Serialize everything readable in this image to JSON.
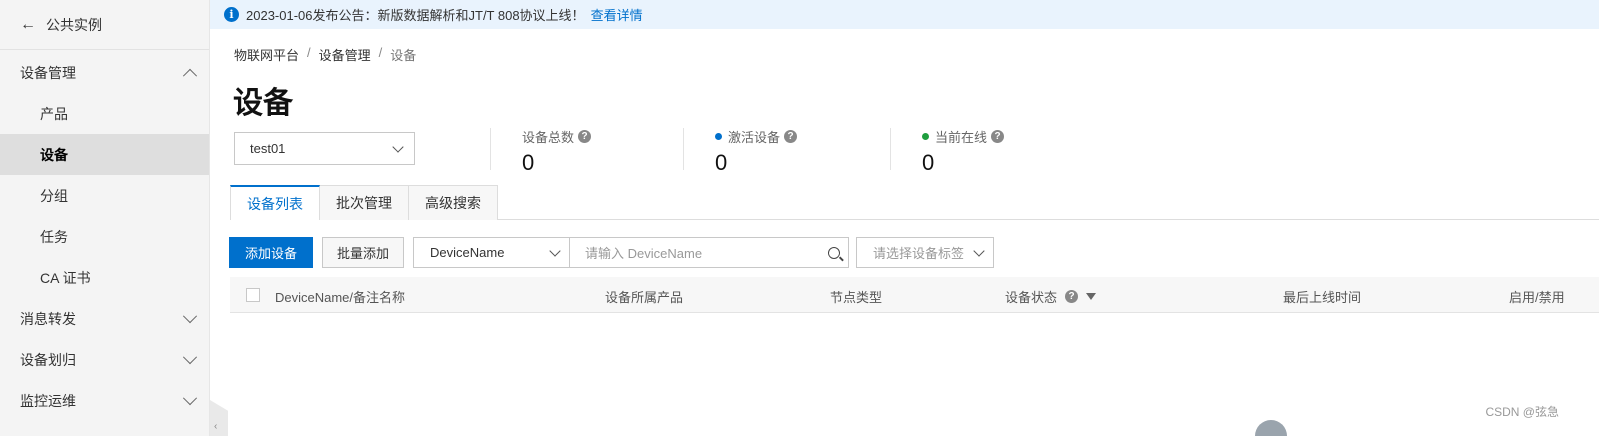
{
  "sidebar": {
    "back_label": "公共实例",
    "groups": [
      {
        "label": "设备管理",
        "expanded": true
      },
      {
        "label": "消息转发",
        "expanded": false
      },
      {
        "label": "设备划归",
        "expanded": false
      },
      {
        "label": "监控运维",
        "expanded": false
      }
    ],
    "items": [
      "产品",
      "设备",
      "分组",
      "任务",
      "CA 证书"
    ],
    "active_item": "设备"
  },
  "notice": {
    "text": "2023-01-06发布公告：新版数据解析和JT/T 808协议上线！",
    "link": "查看详情"
  },
  "breadcrumb": [
    "物联网平台",
    "设备管理",
    "设备"
  ],
  "page_title": "设备",
  "product_select": {
    "value": "test01"
  },
  "stats": [
    {
      "label": "设备总数",
      "value": "0",
      "dot_color": null
    },
    {
      "label": "激活设备",
      "value": "0",
      "dot_color": "#0070cc"
    },
    {
      "label": "当前在线",
      "value": "0",
      "dot_color": "#1e9e3e"
    }
  ],
  "tabs": [
    "设备列表",
    "批次管理",
    "高级搜索"
  ],
  "active_tab": "设备列表",
  "toolbar": {
    "add_label": "添加设备",
    "batch_label": "批量添加",
    "field_select": "DeviceName",
    "search_placeholder": "请输入 DeviceName",
    "tag_placeholder": "请选择设备标签"
  },
  "table": {
    "headers": [
      "DeviceName/备注名称",
      "设备所属产品",
      "节点类型",
      "设备状态",
      "最后上线时间",
      "启用/禁用"
    ]
  },
  "watermark": "CSDN @弦急",
  "colors": {
    "accent": "#0070cc",
    "online": "#1e9e3e",
    "notice_bg": "#e9f3fd"
  }
}
